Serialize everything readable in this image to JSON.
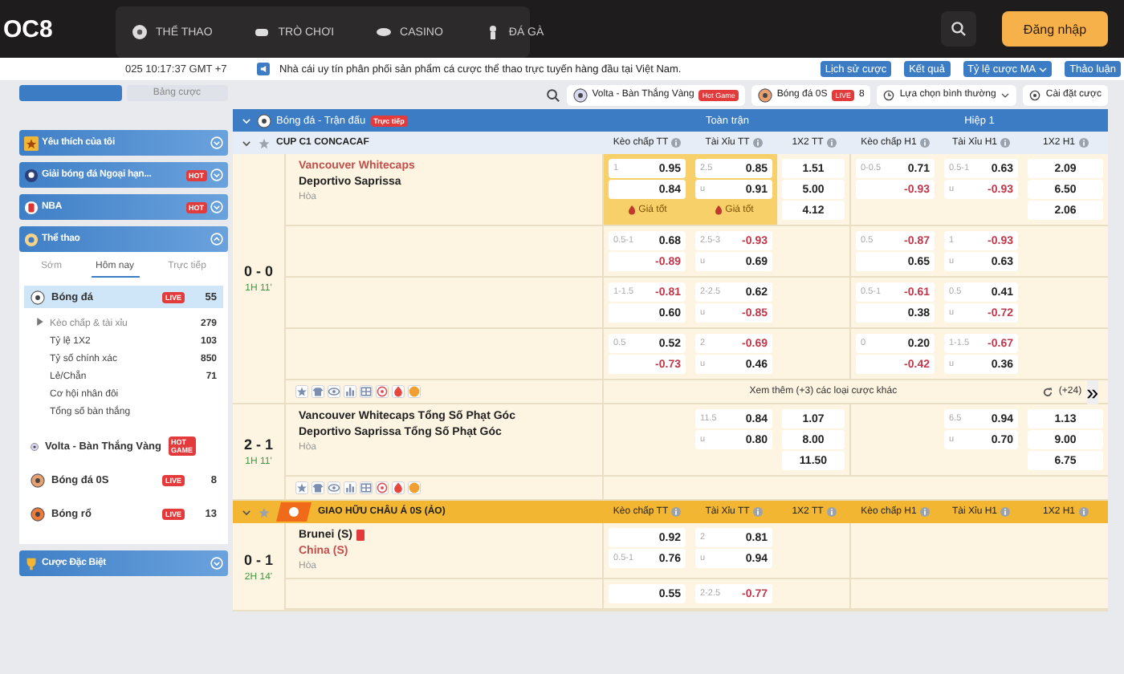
{
  "header": {
    "logo": "OC8",
    "nav": [
      {
        "label": "THỂ THAO"
      },
      {
        "label": "TRÒ CHƠI"
      },
      {
        "label": "CASINO"
      },
      {
        "label": "ĐÁ GÀ"
      }
    ],
    "login": "Đăng nhập"
  },
  "info_bar": {
    "clock": "025 10:17:37 GMT +7",
    "notice": "Nhà cái uy tín phân phối sản phẩm cá cược thể thao trực tuyến hàng đầu tại Việt Nam.",
    "buttons": [
      {
        "label": "Lịch sử cược",
        "dropdown": false
      },
      {
        "label": "Kết quả",
        "dropdown": false
      },
      {
        "label": "Tỷ lệ cược MA",
        "dropdown": true
      },
      {
        "label": "Thảo luận",
        "dropdown": false
      }
    ]
  },
  "sidebar": {
    "tabs": [
      {
        "selected": true
      },
      {
        "label": "Bảng cược",
        "selected": false
      }
    ],
    "sections": [
      {
        "label": "Yêu thích của tôi",
        "expanded": false
      },
      {
        "label": "Giải bóng đá Ngoại hạn...",
        "badge": "HOT",
        "expanded": false
      },
      {
        "label": "NBA",
        "badge": "HOT",
        "expanded": false
      },
      {
        "label": "Thể thao",
        "expanded": true,
        "tabs": [
          {
            "label": "Sớm",
            "selected": false
          },
          {
            "label": "Hôm nay",
            "selected": true
          },
          {
            "label": "Trực tiếp",
            "selected": false
          }
        ],
        "items": [
          {
            "label": "Bóng đá",
            "badge": "LIVE",
            "count": "55",
            "selected": true,
            "children": [
              {
                "label": "Kèo chấp & tài xỉu",
                "count": "279",
                "selected": true
              },
              {
                "label": "Tỷ lệ 1X2",
                "count": "103",
                "selected": false
              },
              {
                "label": "Tỷ số chính xác",
                "count": "850",
                "selected": false
              },
              {
                "label": "Lẻ/Chẵn",
                "count": "71",
                "selected": false
              },
              {
                "label": "Cơ hội nhân đôi",
                "selected": false
              },
              {
                "label": "Tổng số bàn thắng",
                "selected": false
              }
            ]
          },
          {
            "label": "Volta - Bàn Thắng Vàng",
            "badge": "HOT GAME",
            "selected": false
          },
          {
            "label": "Bóng đá 0S",
            "badge": "LIVE",
            "count": "8",
            "selected": false
          },
          {
            "label": "Bóng rổ",
            "badge": "LIVE",
            "count": "13",
            "selected": false
          }
        ]
      },
      {
        "label": "Cược Đặc Biệt",
        "expanded": false
      }
    ]
  },
  "toolbar": {
    "chips": [
      {
        "label": "Volta - Bàn Thắng Vàng",
        "badge": "Hot Game"
      },
      {
        "label": "Bóng đá 0S",
        "badge": "LIVE",
        "count": "8"
      }
    ],
    "view_select": "Lựa chọn bình thường",
    "settings": "Cài đặt cược"
  },
  "board": {
    "title": "Bóng đá - Trận đấu",
    "badge": "Trực tiếp",
    "groups": [
      "Toàn trận",
      "Hiệp 1"
    ],
    "leagues": [
      {
        "name": "CUP C1 CONCACAF",
        "kind": "standard",
        "columns": [
          "Kèo chấp TT",
          "Tài Xỉu TT",
          "1X2 TT",
          "Kèo chấp H1",
          "Tài Xỉu H1",
          "1X2 H1"
        ],
        "matches": [
          {
            "score": "0 - 0",
            "time": "1H 11'",
            "teams": [
              {
                "name": "Vancouver Whitecaps",
                "favorite": true
              },
              {
                "name": "Deportivo Saprissa",
                "favorite": false
              }
            ],
            "draw": "Hòa",
            "lines": [
              {
                "hdp_ft": {
                  "best": true,
                  "note": "Giá tốt",
                  "cells": [
                    {
                      "line": "1",
                      "odds": "0.95"
                    },
                    {
                      "odds": "0.84"
                    }
                  ]
                },
                "ou_ft": {
                  "best": true,
                  "note": "Giá tốt",
                  "cells": [
                    {
                      "line": "2.5",
                      "odds": "0.85"
                    },
                    {
                      "line": "u",
                      "odds": "0.91"
                    }
                  ]
                },
                "x12_ft": {
                  "cells": [
                    {
                      "odds": "1.51"
                    },
                    {
                      "odds": "5.00"
                    },
                    {
                      "odds": "4.12"
                    }
                  ]
                },
                "hdp_h1": {
                  "cells": [
                    {
                      "line": "0-0.5",
                      "odds": "0.71"
                    },
                    {
                      "odds": "-0.93"
                    }
                  ]
                },
                "ou_h1": {
                  "cells": [
                    {
                      "line": "0.5-1",
                      "odds": "0.63"
                    },
                    {
                      "line": "u",
                      "odds": "-0.93"
                    }
                  ]
                },
                "x12_h1": {
                  "cells": [
                    {
                      "odds": "2.09"
                    },
                    {
                      "odds": "6.50"
                    },
                    {
                      "odds": "2.06"
                    }
                  ]
                }
              },
              {
                "hdp_ft": {
                  "cells": [
                    {
                      "line": "0.5-1",
                      "odds": "0.68"
                    },
                    {
                      "odds": "-0.89"
                    }
                  ]
                },
                "ou_ft": {
                  "cells": [
                    {
                      "line": "2.5-3",
                      "odds": "-0.93"
                    },
                    {
                      "line": "u",
                      "odds": "0.69"
                    }
                  ]
                },
                "hdp_h1": {
                  "cells": [
                    {
                      "line": "0.5",
                      "odds": "-0.87"
                    },
                    {
                      "odds": "0.65"
                    }
                  ]
                },
                "ou_h1": {
                  "cells": [
                    {
                      "line": "1",
                      "odds": "-0.93"
                    },
                    {
                      "line": "u",
                      "odds": "0.63"
                    }
                  ]
                }
              },
              {
                "hdp_ft": {
                  "cells": [
                    {
                      "line": "1-1.5",
                      "odds": "-0.81"
                    },
                    {
                      "odds": "0.60"
                    }
                  ]
                },
                "ou_ft": {
                  "cells": [
                    {
                      "line": "2-2.5",
                      "odds": "0.62"
                    },
                    {
                      "line": "u",
                      "odds": "-0.85"
                    }
                  ]
                },
                "hdp_h1": {
                  "cells": [
                    {
                      "line": "0.5-1",
                      "odds": "-0.61"
                    },
                    {
                      "odds": "0.38"
                    }
                  ]
                },
                "ou_h1": {
                  "cells": [
                    {
                      "line": "0.5",
                      "odds": "0.41"
                    },
                    {
                      "line": "u",
                      "odds": "-0.72"
                    }
                  ]
                }
              },
              {
                "hdp_ft": {
                  "cells": [
                    {
                      "line": "0.5",
                      "odds": "0.52"
                    },
                    {
                      "odds": "-0.73"
                    }
                  ]
                },
                "ou_ft": {
                  "cells": [
                    {
                      "line": "2",
                      "odds": "-0.69"
                    },
                    {
                      "line": "u",
                      "odds": "0.46"
                    }
                  ]
                },
                "hdp_h1": {
                  "cells": [
                    {
                      "line": "0",
                      "odds": "0.20"
                    },
                    {
                      "odds": "-0.42"
                    }
                  ]
                },
                "ou_h1": {
                  "cells": [
                    {
                      "line": "1-1.5",
                      "odds": "-0.67"
                    },
                    {
                      "line": "u",
                      "odds": "0.36"
                    }
                  ]
                }
              }
            ],
            "tools": true,
            "footer": {
              "more": "Xem thêm (+3) các loại cược khác",
              "extra": "(+24)",
              "next": "»"
            }
          },
          {
            "score": "2 - 1",
            "time": "1H 11'",
            "teams": [
              {
                "name": "Vancouver Whitecaps Tổng Số Phạt Góc",
                "favorite": false
              },
              {
                "name": "Deportivo Saprissa Tổng Số Phạt Góc",
                "favorite": false
              }
            ],
            "draw": "Hòa",
            "lines": [
              {
                "ou_ft": {
                  "cells": [
                    {
                      "line": "11.5",
                      "odds": "0.84"
                    },
                    {
                      "line": "u",
                      "odds": "0.80"
                    }
                  ]
                },
                "x12_ft": {
                  "cells": [
                    {
                      "odds": "1.07"
                    },
                    {
                      "odds": "8.00"
                    },
                    {
                      "odds": "11.50"
                    }
                  ]
                },
                "ou_h1": {
                  "cells": [
                    {
                      "line": "6.5",
                      "odds": "0.94"
                    },
                    {
                      "line": "u",
                      "odds": "0.70"
                    }
                  ]
                },
                "x12_h1": {
                  "cells": [
                    {
                      "odds": "1.13"
                    },
                    {
                      "odds": "9.00"
                    },
                    {
                      "odds": "6.75"
                    }
                  ]
                }
              }
            ],
            "tools": true
          }
        ]
      },
      {
        "name": "GIAO HỮU CHÂU Á 0S (ẢO)",
        "kind": "featured",
        "columns": [
          "Kèo chấp TT",
          "Tài Xỉu TT",
          "1X2 TT",
          "Kèo chấp H1",
          "Tài Xỉu H1",
          "1X2 H1"
        ],
        "matches": [
          {
            "score": "0 - 1",
            "time": "2H 14'",
            "teams": [
              {
                "name": "Brunei (S)",
                "favorite": false,
                "red_card": true
              },
              {
                "name": "China (S)",
                "favorite": true
              }
            ],
            "draw": "Hòa",
            "lines": [
              {
                "hdp_ft": {
                  "cells": [
                    {
                      "odds": "0.92"
                    },
                    {
                      "line": "0.5-1",
                      "odds": "0.76"
                    }
                  ]
                },
                "ou_ft": {
                  "cells": [
                    {
                      "line": "2",
                      "odds": "0.81"
                    },
                    {
                      "line": "u",
                      "odds": "0.94"
                    }
                  ]
                }
              },
              {
                "hdp_ft": {
                  "cells": [
                    {
                      "odds": "0.55"
                    }
                  ]
                },
                "ou_ft": {
                  "cells": [
                    {
                      "line": "2-2.5",
                      "odds": "-0.77"
                    }
                  ]
                }
              }
            ]
          }
        ]
      }
    ]
  }
}
